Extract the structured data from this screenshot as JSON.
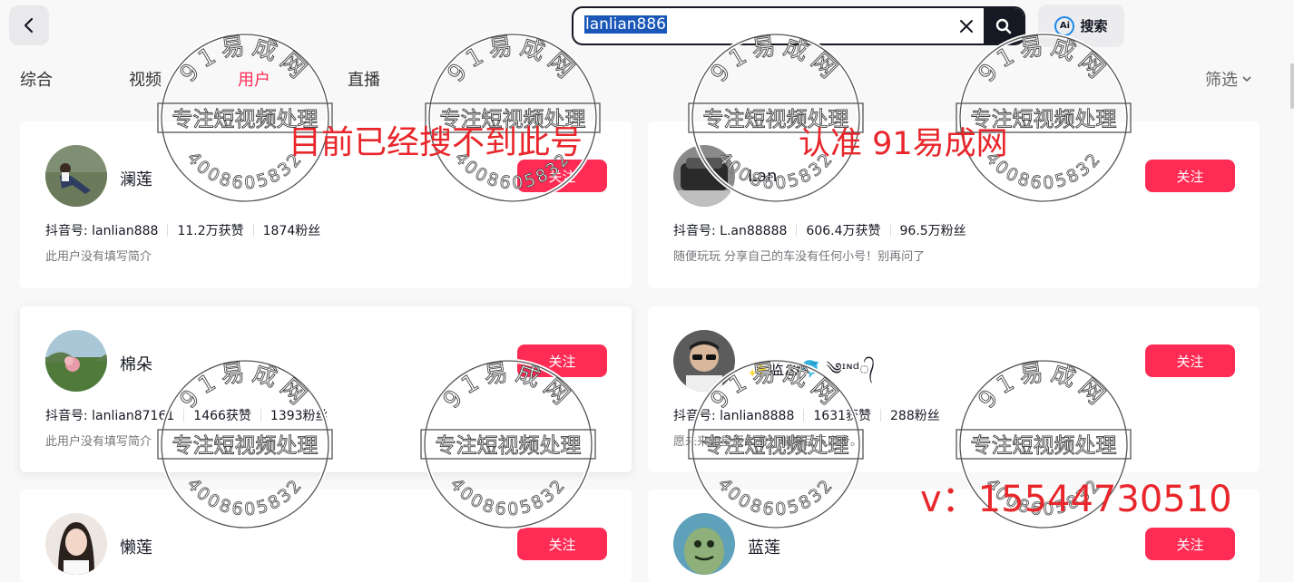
{
  "search": {
    "query": "lanlian886",
    "ai_label": "搜索",
    "ai_badge": "Ai"
  },
  "tabs": [
    "综合",
    "视频",
    "用户",
    "直播"
  ],
  "active_tab": "用户",
  "filter_label": "筛选",
  "follow_label": "关注",
  "users": [
    {
      "name": "澜莲",
      "id_label": "抖音号: lanlian888",
      "likes": "11.2万获赞",
      "fans": "1874粉丝",
      "bio": "此用户没有填写简介"
    },
    {
      "name": "Lan",
      "id_label": "抖音号: L.an88888",
      "likes": "606.4万获赞",
      "fans": "96.5万粉丝",
      "bio": "随便玩玩 分享自己的车没有任何小号！别再问了"
    },
    {
      "name": "棉朵",
      "id_label": "抖音号: lanlian87161",
      "likes": "1466获赞",
      "fans": "1393粉丝",
      "bio": "此用户没有填写简介"
    },
    {
      "name": "✨蓝恋🐬 ༄ᶦᶰᵈ᭄",
      "id_label": "抖音号: lanlian8888",
      "likes": "1631获赞",
      "fans": "288粉丝",
      "bio": "愿未来如星辰大海，璀璨且不止步。"
    },
    {
      "name": "懒莲"
    },
    {
      "name": "蓝莲"
    }
  ],
  "watermark": {
    "top_text": "91易成网",
    "middle_text": "专注短视频处理",
    "bottom_text": "4008605832",
    "note_left": "目前已经搜不到此号",
    "note_right": "认准 91易成网",
    "contact": "v：15544730510"
  },
  "colors": {
    "accent": "#fe2c55",
    "watermark_red": "#e8262b",
    "selection": "#1a57b8"
  }
}
